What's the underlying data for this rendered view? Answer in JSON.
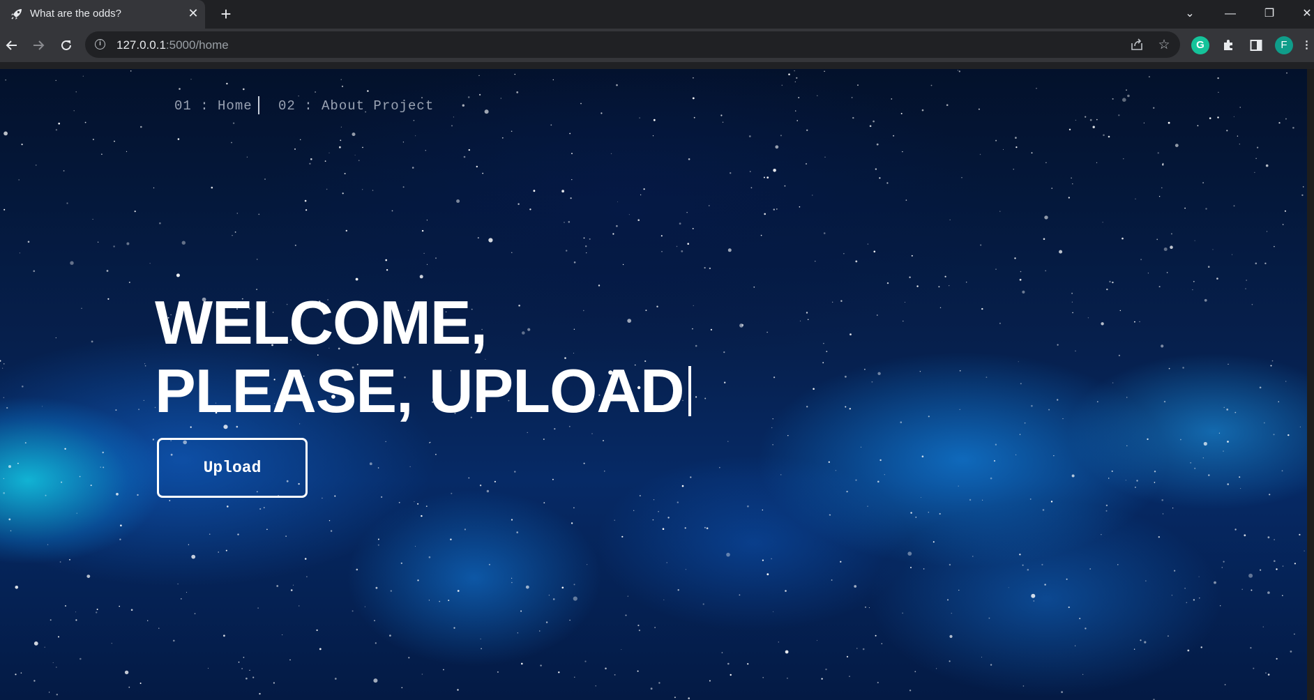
{
  "browser": {
    "tab_title": "What are the odds?",
    "tab_close": "✕",
    "new_tab": "+",
    "url_host": "127.0.0.1",
    "url_path": ":5000/home",
    "profile_initial": "F",
    "extension_initial": "G",
    "window_controls": {
      "dropdown": "⌄",
      "minimize": "—",
      "restore": "❐",
      "close": "✕"
    }
  },
  "page": {
    "nav": {
      "home_label": "01 : Home",
      "about_label": "02 : About Project"
    },
    "hero": {
      "line1": "WELCOME,",
      "line2": "PLEASE, UPLOAD"
    },
    "upload_button": "Upload"
  },
  "colors": {
    "tab_bg": "#35363a",
    "chrome_bg": "#202124",
    "accent_extension": "#15c39a",
    "profile": "#0f9d8a"
  }
}
